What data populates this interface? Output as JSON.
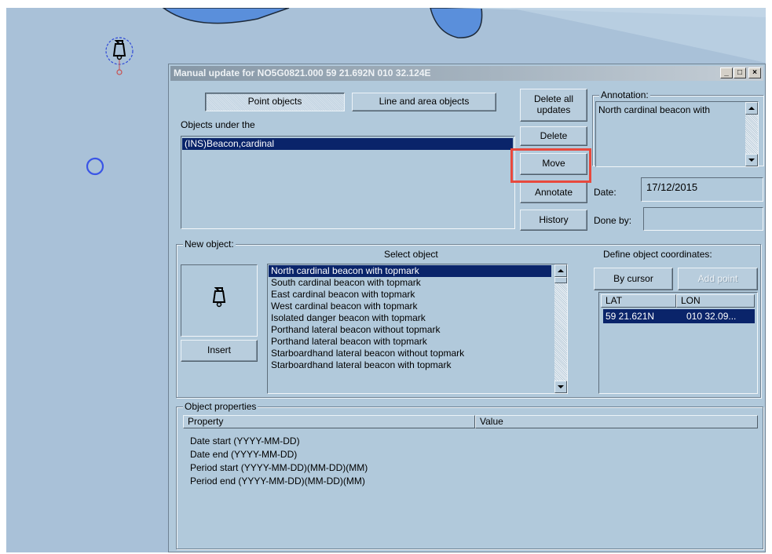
{
  "window": {
    "title": "Manual update for NO5G0821.000  59 21.692N  010 32.124E",
    "minimize_glyph": "_",
    "maximize_glyph": "□",
    "close_glyph": "×"
  },
  "tabs": [
    {
      "label": "Point objects",
      "selected": true
    },
    {
      "label": "Line and area objects",
      "selected": false
    }
  ],
  "objects_under": {
    "label": "Objects under the",
    "items": [
      {
        "label": "(INS)Beacon,cardinal",
        "selected": true
      }
    ]
  },
  "actions": {
    "delete_all": "Delete all updates",
    "delete": "Delete",
    "move": "Move",
    "annotate": "Annotate",
    "history": "History"
  },
  "annotation": {
    "label": "Annotation:",
    "text": "North cardinal beacon with"
  },
  "date": {
    "label": "Date:",
    "value": "17/12/2015"
  },
  "done_by": {
    "label": "Done by:",
    "value": ""
  },
  "new_object": {
    "label": "New object:",
    "insert_label": "Insert",
    "select_label": "Select object",
    "items": [
      {
        "label": "North cardinal beacon with topmark",
        "selected": true
      },
      {
        "label": "South cardinal beacon with topmark",
        "selected": false
      },
      {
        "label": "East cardinal beacon with topmark",
        "selected": false
      },
      {
        "label": "West cardinal beacon with topmark",
        "selected": false
      },
      {
        "label": "Isolated danger beacon with topmark",
        "selected": false
      },
      {
        "label": "Porthand lateral beacon without topmark",
        "selected": false
      },
      {
        "label": "Porthand lateral beacon with topmark",
        "selected": false
      },
      {
        "label": "Starboardhand lateral beacon without topmark",
        "selected": false
      },
      {
        "label": "Starboardhand lateral beacon with topmark",
        "selected": false
      }
    ]
  },
  "coordinates": {
    "label": "Define object coordinates:",
    "by_cursor": "By cursor",
    "add_point": "Add point",
    "columns": [
      "LAT",
      "LON"
    ],
    "rows": [
      {
        "lat": "59 21.621N",
        "lon": "010 32.09..."
      }
    ]
  },
  "properties": {
    "label": "Object properties",
    "columns": [
      "Property",
      "Value"
    ],
    "rows": [
      "Date start (YYYY-MM-DD)",
      "Date end (YYYY-MM-DD)",
      "Period start (YYYY-MM-DD)(MM-DD)(MM)",
      "Period end (YYYY-MM-DD)(MM-DD)(MM)"
    ]
  },
  "icons": [
    "beacon-icon",
    "circle-marker-icon",
    "selected-beacon-icon"
  ],
  "colors": {
    "water": "#a9c1d8",
    "deep_water": "#5a8fdb",
    "dialog_bg": "#b1c9db",
    "selection": "#0a246a",
    "highlight": "#e8493d",
    "marker": "#3a55e6"
  }
}
